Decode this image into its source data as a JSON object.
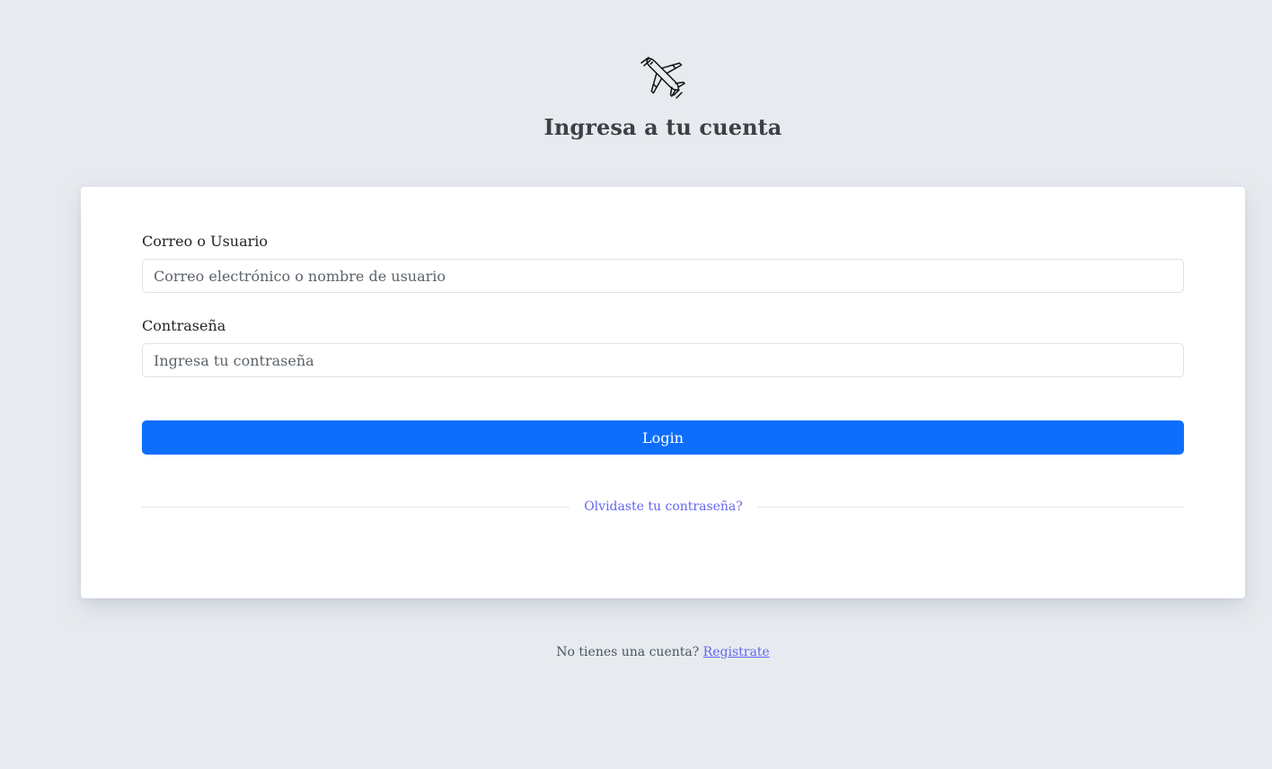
{
  "header": {
    "logo_icon": "airplane-icon",
    "title": "Ingresa a tu cuenta"
  },
  "form": {
    "username": {
      "label": "Correo o Usuario",
      "placeholder": "Correo electrónico o nombre de usuario",
      "value": ""
    },
    "password": {
      "label": "Contraseña",
      "placeholder": "Ingresa tu contraseña",
      "value": ""
    },
    "login_label": "Login",
    "forgot_label": "Olvidaste tu contraseña?"
  },
  "footer": {
    "prompt": "No tienes una cuenta?",
    "register_label": "Registrate"
  },
  "colors": {
    "background": "#e7ebef",
    "primary": "#0d6efd",
    "link": "#6366f1"
  }
}
